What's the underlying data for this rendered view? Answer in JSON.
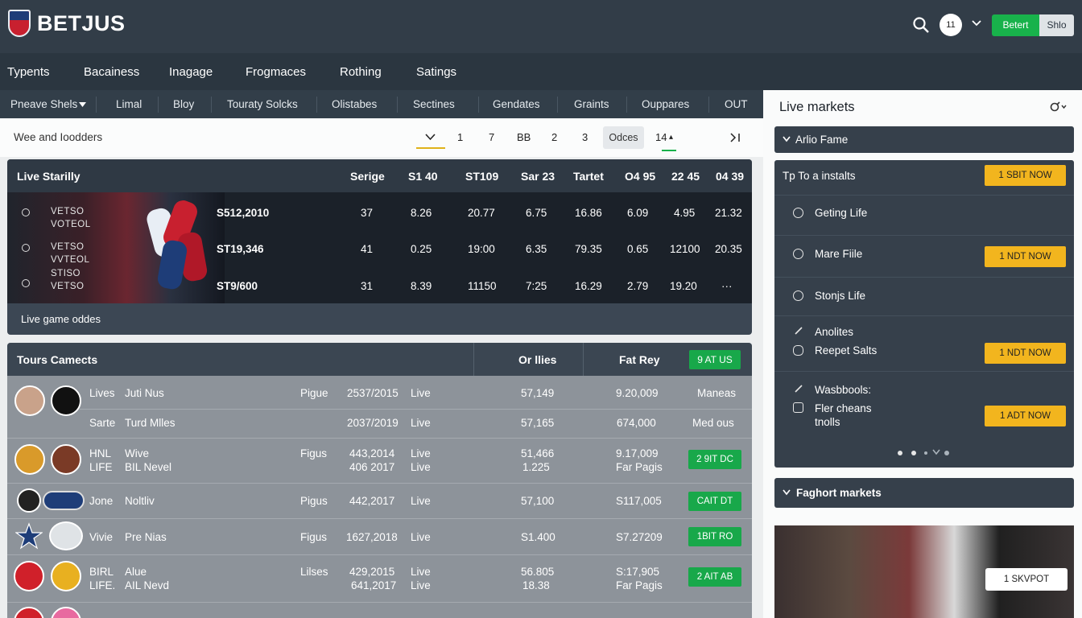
{
  "brand": {
    "name": "BETJUS"
  },
  "header": {
    "user_badge": "11",
    "primary_button": "Betert",
    "secondary_button": "Shlo"
  },
  "nav": {
    "items": [
      "Typents",
      "Bacainess",
      "Inagage",
      "Frogmaces",
      "Rothing",
      "Satings"
    ]
  },
  "subnav": {
    "items": [
      "Pneave Shels",
      "Limal",
      "Bloy",
      "Touraty Solcks",
      "Olistabes",
      "Sectines",
      "Gendates",
      "Graints",
      "Ouppares",
      "OUT"
    ]
  },
  "filter": {
    "label": "Wee and Ioodders",
    "pages": [
      "1",
      "7",
      "BB",
      "2",
      "3"
    ],
    "orders": "Odces",
    "last": "14"
  },
  "live": {
    "title": "Live Starilly",
    "columns": [
      "Serige",
      "S1 40",
      "ST109",
      "Sar 23",
      "Tartet",
      "O4 95",
      "22 45",
      "04 39"
    ],
    "teams": [
      "VETSO",
      "VOTEOL",
      "VETSO",
      "VVTEOL",
      "STISO",
      "VETSO"
    ],
    "rows": [
      {
        "amount": "S512,2010",
        "cells": [
          "37",
          "8.26",
          "20.77",
          "6.75",
          "16.86",
          "6.09",
          "4.95",
          "21.32"
        ]
      },
      {
        "amount": "ST19,346",
        "cells": [
          "41",
          "0.25",
          "19:00",
          "6.35",
          "79.35",
          "0.65",
          "12100",
          "20.35"
        ]
      },
      {
        "amount": "ST9/600",
        "cells": [
          "31",
          "8.39",
          "11150",
          "7:25",
          "16.29",
          "2.79",
          "19.20",
          "···"
        ]
      }
    ],
    "footer": "Live game oddes"
  },
  "tours": {
    "title": "Tours Camects",
    "col_odds": "Or llies",
    "col_fee": "Fat Rey",
    "head_button": "9 AT US",
    "rows": [
      {
        "a": "Lives",
        "b": "Juti Nus",
        "c": "Pigue",
        "d": "2537/2015",
        "e": "Live",
        "f": "57,149",
        "g": "9.20,009",
        "h": "Maneas"
      },
      {
        "a": "Sarte",
        "b": "Turd Mlles",
        "c": "",
        "d": "2037/2019",
        "e": "Live",
        "f": "57,165",
        "g": "674,000",
        "h": "Med ous"
      },
      {
        "a": "HNL",
        "a2": "LIFE",
        "b": "Wive",
        "b2": "BIL Nevel",
        "c": "Figus",
        "d": "443,2014",
        "d2": "406 2017",
        "e": "Live",
        "e2": "Live",
        "f": "51,466",
        "f2": "1.225",
        "g": "9.17,009",
        "g2": "Far Pagis",
        "btn": "2 9IT DC"
      },
      {
        "a": "Jone",
        "b": "Noltliv",
        "c": "Pigus",
        "d": "442,2017",
        "e": "Live",
        "f": "57,100",
        "g": "S117,005",
        "btn": "CAIT DT"
      },
      {
        "a": "Vivie",
        "b": "Pre Nias",
        "c": "Figus",
        "d": "1627,2018",
        "e": "Live",
        "f": "S1.400",
        "g": "S7.27209",
        "btn": "1BIT RO"
      },
      {
        "a": "BIRL",
        "a2": "LIFE.",
        "b": "Alue",
        "b2": "AIL Nevd",
        "c": "Lilses",
        "d": "429,2015",
        "d2": "641,2017",
        "e": "Live",
        "e2": "Live",
        "f": "56.805",
        "f2": "18.38",
        "g": "S:17,905",
        "g2": "Far Pagis",
        "btn": "2 AIT AB"
      }
    ]
  },
  "right": {
    "title": "Live markets",
    "arlio": "Arlio Fame",
    "markets_title": "Tp To a instalts",
    "markets_button": "1 SBIT NOW",
    "items": [
      {
        "label": "Geting Life"
      },
      {
        "label": "Mare Fiile",
        "button": "1 NDT NOW"
      },
      {
        "label": "Stonjs Life"
      },
      {
        "label": "Anolites",
        "label2": "Reepet Salts",
        "button": "1 NDT NOW"
      },
      {
        "label": "Wasbbools:",
        "label2": "Fler cheans",
        "label3": "tnolls",
        "button": "1 ADT NOW"
      }
    ],
    "featured": "Faghort markets",
    "photo_button": "1 SKVPOT"
  },
  "colors": {
    "topbar": "#323d48",
    "accent_green": "#18b24b",
    "accent_yellow": "#f2b51e",
    "panel_dark": "#36404b"
  }
}
